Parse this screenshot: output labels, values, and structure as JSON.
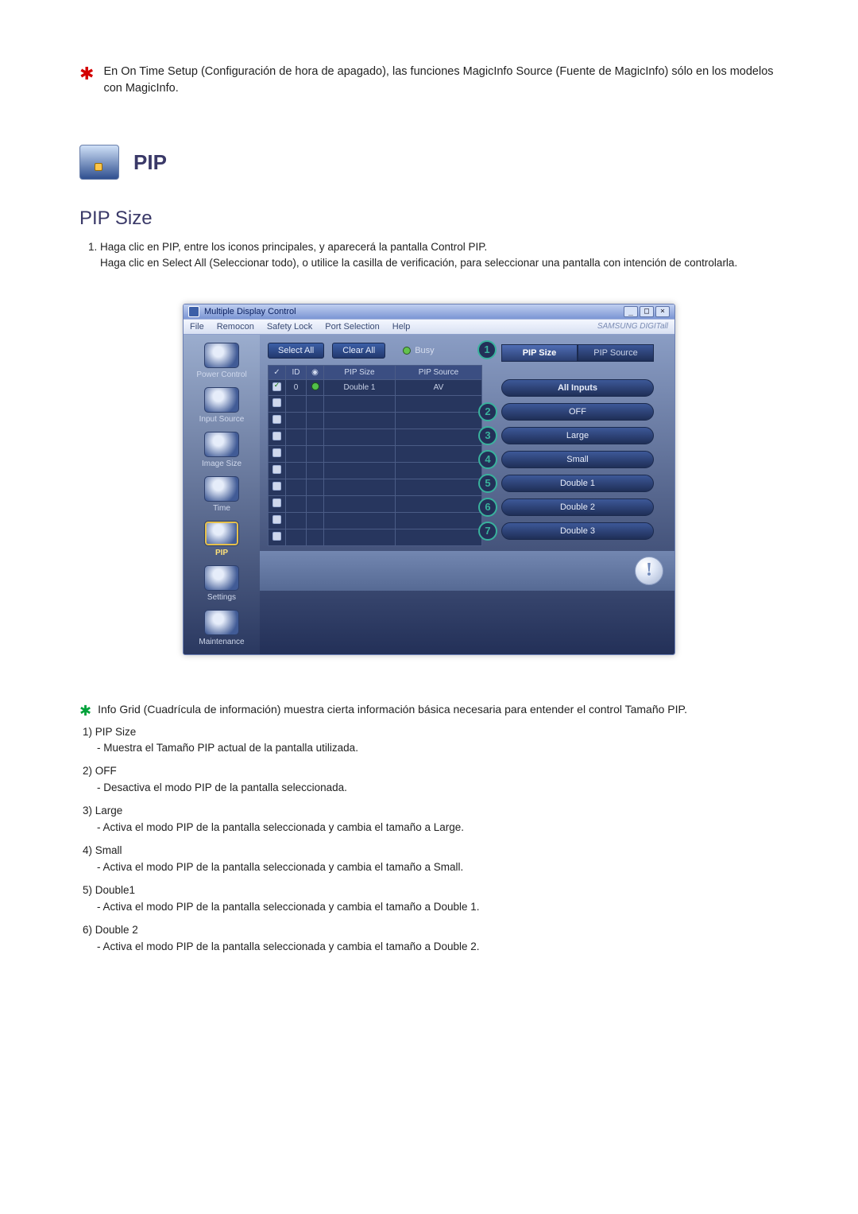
{
  "top_note": "En On Time Setup (Configuración de hora de apagado), las funciones MagicInfo Source (Fuente de MagicInfo) sólo en los modelos con MagicInfo.",
  "heading_pip": "PIP",
  "heading_pip_size": "PIP Size",
  "intro_num": "1.",
  "intro_line1": "Haga clic en PIP, entre los iconos principales, y aparecerá la pantalla Control PIP.",
  "intro_line2": "Haga clic en Select All (Seleccionar todo), o utilice la casilla de verificación, para seleccionar una pantalla con intención de controlarla.",
  "app": {
    "title": "Multiple Display Control",
    "brand": "SAMSUNG DIGITall",
    "menu": {
      "file": "File",
      "remocon": "Remocon",
      "safety": "Safety Lock",
      "port": "Port Selection",
      "help": "Help"
    },
    "win": {
      "min": "_",
      "max": "□",
      "close": "×"
    },
    "sidebar": {
      "power": "Power Control",
      "input": "Input Source",
      "image": "Image Size",
      "time": "Time",
      "pip": "PIP",
      "settings": "Settings",
      "maint": "Maintenance"
    },
    "toolbar": {
      "select_all": "Select All",
      "clear_all": "Clear All",
      "busy": "Busy"
    },
    "grid": {
      "headers": {
        "chk": "✓",
        "id": "ID",
        "status": "◉",
        "pip_size": "PIP Size",
        "pip_source": "PIP Source"
      },
      "row0": {
        "id": "0",
        "size": "Double 1",
        "source": "AV"
      }
    },
    "tabs": {
      "size": "PIP Size",
      "source": "PIP Source",
      "num1": "1"
    },
    "options": {
      "allinputs": "All Inputs",
      "off": {
        "num": "2",
        "label": "OFF"
      },
      "large": {
        "num": "3",
        "label": "Large"
      },
      "small": {
        "num": "4",
        "label": "Small"
      },
      "double1": {
        "num": "5",
        "label": "Double 1"
      },
      "double2": {
        "num": "6",
        "label": "Double 2"
      },
      "double3": {
        "num": "7",
        "label": "Double 3"
      }
    },
    "alert_glyph": "!"
  },
  "info_note": "Info Grid (Cuadrícula de información) muestra cierta información básica necesaria para entender el control Tamaño PIP.",
  "legend": {
    "i1": {
      "label": "1)  PIP Size",
      "desc": "- Muestra el Tamaño PIP actual de la pantalla utilizada."
    },
    "i2": {
      "label": "2)  OFF",
      "desc": "- Desactiva el modo PIP de la pantalla seleccionada."
    },
    "i3": {
      "label": "3)  Large",
      "desc": "- Activa el modo PIP de la pantalla seleccionada y cambia el tamaño a Large."
    },
    "i4": {
      "label": "4)  Small",
      "desc": "- Activa el modo PIP de la pantalla seleccionada y cambia el tamaño a Small."
    },
    "i5": {
      "label": "5)  Double1",
      "desc": "- Activa el modo PIP de la pantalla seleccionada y cambia el tamaño a Double 1."
    },
    "i6": {
      "label": "6)  Double 2",
      "desc": "- Activa el modo PIP de la pantalla seleccionada y cambia el tamaño a Double 2."
    }
  }
}
